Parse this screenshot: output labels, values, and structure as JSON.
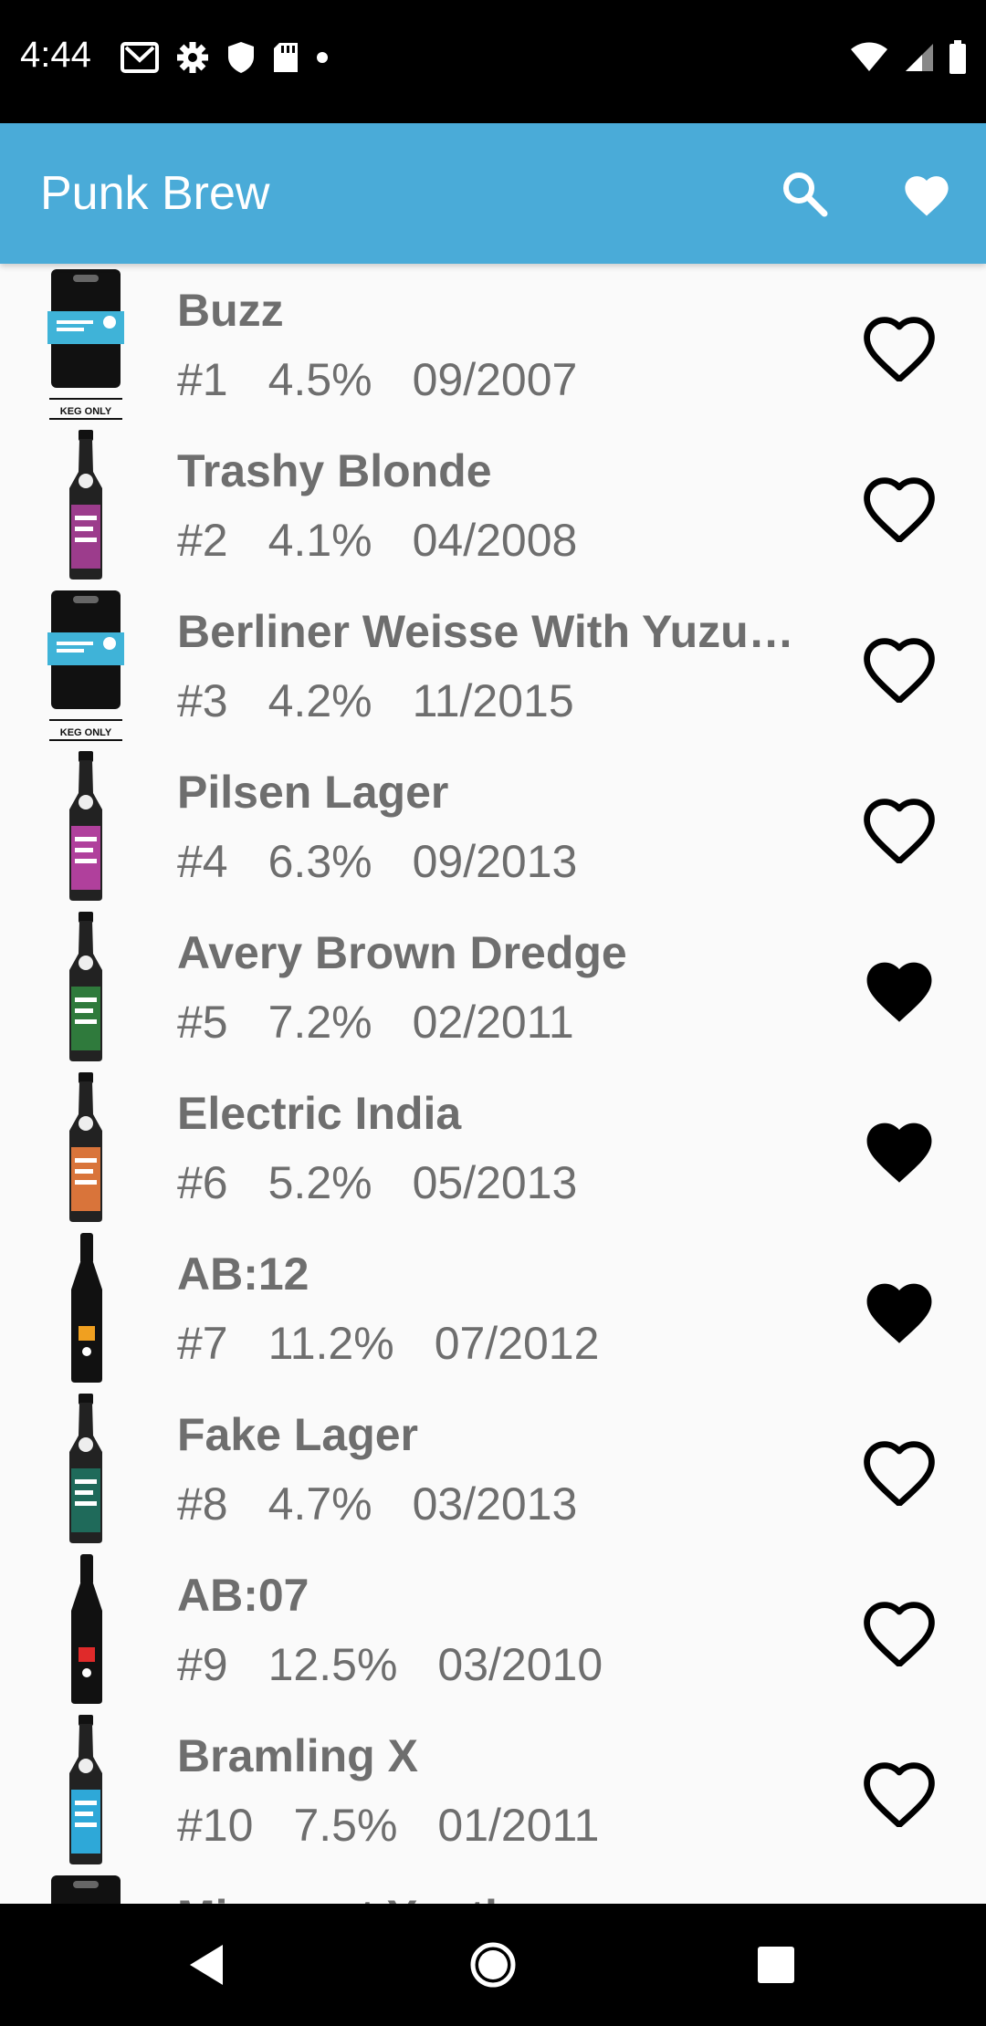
{
  "status_bar": {
    "time": "4:44",
    "icons_left": [
      "gmail-icon",
      "settings-icon",
      "shield-icon",
      "sd-card-icon",
      "dot-icon"
    ],
    "icons_right": [
      "wifi-icon",
      "cellular-icon",
      "battery-icon"
    ]
  },
  "app_bar": {
    "title": "Punk Brew",
    "actions": [
      "search-icon",
      "heart-filled-icon"
    ],
    "color": "#4aabd8"
  },
  "beers": [
    {
      "name": "Buzz",
      "id": "#1",
      "abv": "4.5%",
      "date": "09/2007",
      "favorite": false,
      "thumb": "keg",
      "label_color": "#3fb3d8"
    },
    {
      "name": "Trashy Blonde",
      "id": "#2",
      "abv": "4.1%",
      "date": "04/2008",
      "favorite": false,
      "thumb": "bottle",
      "label_color": "#9c3c8c"
    },
    {
      "name": "Berliner Weisse With Yuzu…",
      "id": "#3",
      "abv": "4.2%",
      "date": "11/2015",
      "favorite": false,
      "thumb": "keg",
      "label_color": "#3fb3d8"
    },
    {
      "name": "Pilsen Lager",
      "id": "#4",
      "abv": "6.3%",
      "date": "09/2013",
      "favorite": false,
      "thumb": "bottle",
      "label_color": "#b0409c"
    },
    {
      "name": "Avery Brown Dredge",
      "id": "#5",
      "abv": "7.2%",
      "date": "02/2011",
      "favorite": true,
      "thumb": "bottle",
      "label_color": "#2f7a3c"
    },
    {
      "name": "Electric India",
      "id": "#6",
      "abv": "5.2%",
      "date": "05/2013",
      "favorite": true,
      "thumb": "bottle",
      "label_color": "#d9743a"
    },
    {
      "name": "AB:12",
      "id": "#7",
      "abv": "11.2%",
      "date": "07/2012",
      "favorite": true,
      "thumb": "tall-bottle",
      "label_color": "#f0a020"
    },
    {
      "name": "Fake Lager",
      "id": "#8",
      "abv": "4.7%",
      "date": "03/2013",
      "favorite": false,
      "thumb": "bottle",
      "label_color": "#1f6a5a"
    },
    {
      "name": "AB:07",
      "id": "#9",
      "abv": "12.5%",
      "date": "03/2010",
      "favorite": false,
      "thumb": "tall-bottle",
      "label_color": "#e02a2a"
    },
    {
      "name": "Bramling X",
      "id": "#10",
      "abv": "7.5%",
      "date": "01/2011",
      "favorite": false,
      "thumb": "bottle",
      "label_color": "#2ea8d8"
    },
    {
      "name": "Misspent Youth",
      "id": "#11",
      "abv": "",
      "date": "",
      "favorite": false,
      "thumb": "keg",
      "label_color": "#3fb3d8"
    }
  ],
  "keg_text": "KEG ONLY",
  "nav_bar": {
    "buttons": [
      "back-icon",
      "home-icon",
      "recents-icon"
    ]
  }
}
